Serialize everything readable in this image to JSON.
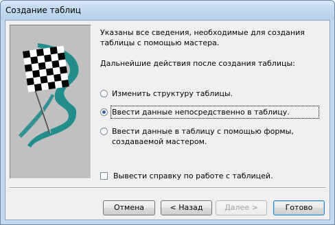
{
  "window": {
    "title": "Создание таблиц"
  },
  "intro_text": "Указаны все сведения, необходимые для создания таблицы с помощью мастера.",
  "question": "Дальнейшие действия после создания таблицы:",
  "options": [
    {
      "label": "Изменить структуру таблицы.",
      "selected": false
    },
    {
      "label": "Ввести данные непосредственно в таблицу.",
      "selected": true
    },
    {
      "label": "Ввести данные в таблицу с помощью формы, создаваемой мастером.",
      "selected": false
    }
  ],
  "help_checkbox": {
    "label": "Вывести справку по работе с таблицей.",
    "checked": false
  },
  "buttons": {
    "cancel": "Отмена",
    "back": "< Назад",
    "next": "Далее >",
    "finish": "Готово"
  },
  "colors": {
    "accent": "#2c5fb3",
    "graphic_panel": "#c0c0c0",
    "graphic_swoosh": "#1a8a88"
  }
}
